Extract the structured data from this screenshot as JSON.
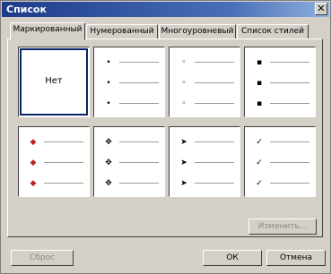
{
  "window": {
    "title": "Список",
    "close_symbol": "✕"
  },
  "tabs": [
    {
      "label": "Маркированный",
      "active": true
    },
    {
      "label": "Нумерованный",
      "active": false
    },
    {
      "label": "Многоуровневый",
      "active": false
    },
    {
      "label": "Список стилей",
      "active": false
    }
  ],
  "gallery": {
    "none_label": "Нет",
    "marks": [
      "•",
      "◦",
      "▪",
      "◆",
      "✥",
      "➤",
      "✓"
    ]
  },
  "buttons": {
    "customize": "Изменить...",
    "reset": "Сброс",
    "ok": "ОК",
    "cancel": "Отмена"
  }
}
